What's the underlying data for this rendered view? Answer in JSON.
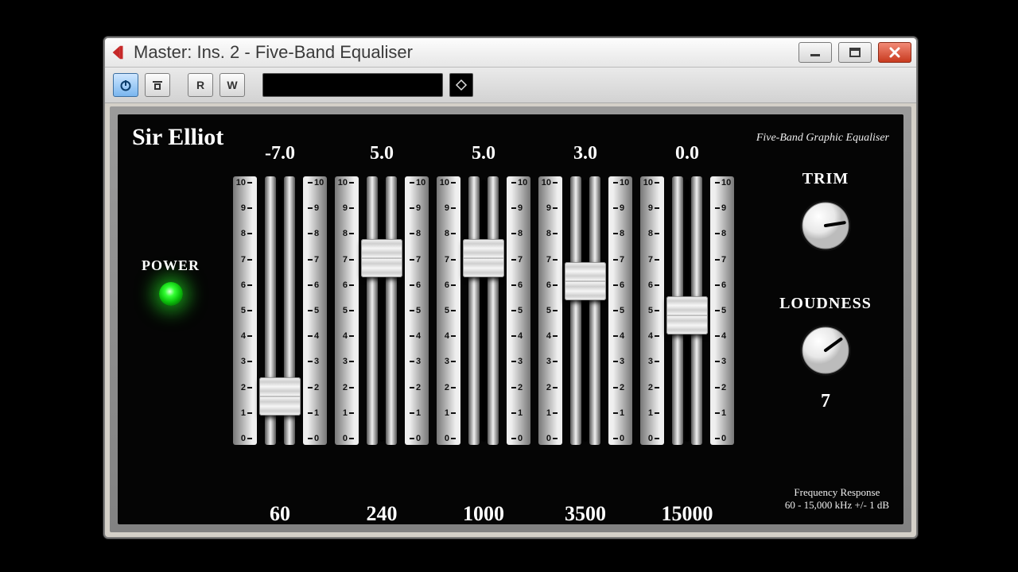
{
  "window": {
    "title": "Master: Ins. 2 - Five-Band Equaliser"
  },
  "plugin": {
    "brand": "Sir Elliot",
    "subtitle": "Five-Band Graphic Equaliser",
    "power_label": "POWER",
    "power_on": true,
    "freq_response_1": "Frequency Response",
    "freq_response_2": "60 - 15,000 kHz  +/- 1 dB",
    "scale_max": 10,
    "scale_min": 0,
    "bands": [
      {
        "gain_display": "-7.0",
        "gain": -7.0,
        "freq": "60"
      },
      {
        "gain_display": "5.0",
        "gain": 5.0,
        "freq": "240"
      },
      {
        "gain_display": "5.0",
        "gain": 5.0,
        "freq": "1000"
      },
      {
        "gain_display": "3.0",
        "gain": 3.0,
        "freq": "3500"
      },
      {
        "gain_display": "0.0",
        "gain": 0.0,
        "freq": "15000"
      }
    ],
    "trim": {
      "label": "TRIM",
      "value": 8,
      "min": 0,
      "max": 10
    },
    "loudness": {
      "label": "LOUDNESS",
      "value": 7,
      "display": "7",
      "min": 0,
      "max": 10
    }
  },
  "colors": {
    "power_led": "#1eff1e",
    "close_btn": "#c83a1f"
  }
}
